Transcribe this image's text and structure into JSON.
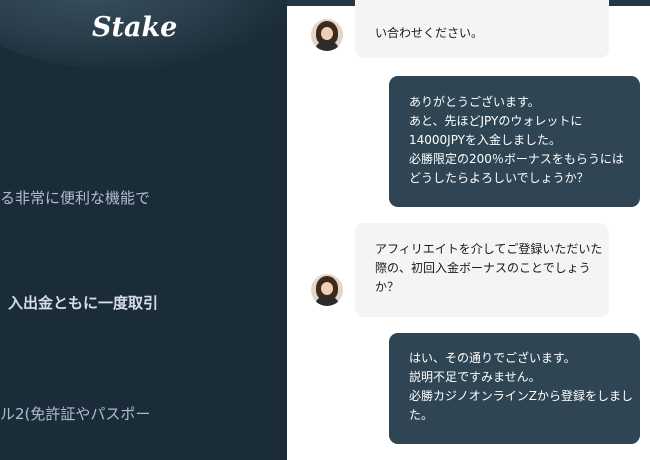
{
  "brand": {
    "logo_text": "Stake"
  },
  "background_text": {
    "line1": "る非常に便利な機能で",
    "line2": "入出金ともに一度取引",
    "line3": "ル2(免許証やパスポー"
  },
  "chat": {
    "messages": [
      {
        "sender": "agent",
        "text": "い合わせください。"
      },
      {
        "sender": "user",
        "lines": [
          "ありがとうございます。",
          "あと、先ほどJPYのウォレットに",
          "14000JPYを入金しました。",
          "必勝限定の200％ボーナスをもらうには",
          "どうしたらよろしいでしょうか？"
        ]
      },
      {
        "sender": "agent",
        "lines": [
          "アフィリエイトを介してご登録いただいた",
          "際の、初回入金ボーナスのことでしょう",
          "か？"
        ]
      },
      {
        "sender": "user",
        "lines": [
          "はい、その通りでございます。",
          "説明不足ですみません。",
          "必勝カジノオンラインZから登録をしまし",
          "た。"
        ]
      }
    ]
  },
  "colors": {
    "sidebar_bg": "#1a2c38",
    "user_bubble": "#2f4553",
    "agent_bubble": "#f4f4f4",
    "online": "#1fff20"
  }
}
